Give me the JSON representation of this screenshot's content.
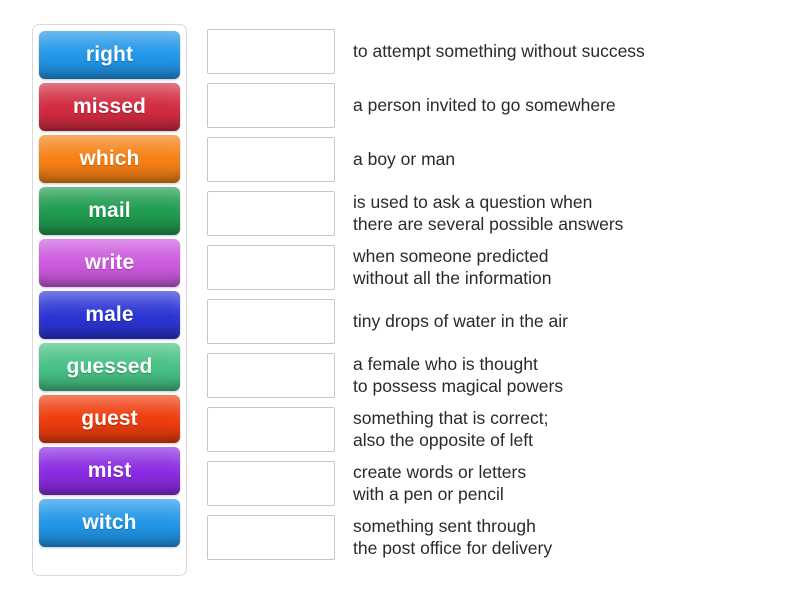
{
  "activity": {
    "type": "match-up",
    "tile_panel": {
      "name": "word-bank",
      "tiles": [
        {
          "label": "right",
          "color": "#2196e8"
        },
        {
          "label": "missed",
          "color": "#d22b41"
        },
        {
          "label": "which",
          "color": "#f58014"
        },
        {
          "label": "mail",
          "color": "#1e9b4e"
        },
        {
          "label": "write",
          "color": "#cc5ade"
        },
        {
          "label": "male",
          "color": "#2b35d4"
        },
        {
          "label": "guessed",
          "color": "#45c183"
        },
        {
          "label": "guest",
          "color": "#ee3c0d"
        },
        {
          "label": "mist",
          "color": "#8b2be2"
        },
        {
          "label": "witch",
          "color": "#2196e8"
        }
      ]
    },
    "answers": {
      "name": "definition-list",
      "rows": [
        {
          "value": "",
          "definition": "to attempt something without success"
        },
        {
          "value": "",
          "definition": "a person invited to go somewhere"
        },
        {
          "value": "",
          "definition": "a boy or man"
        },
        {
          "value": "",
          "definition": "is used to ask a question when\nthere are several possible answers"
        },
        {
          "value": "",
          "definition": "when someone predicted\nwithout all the information"
        },
        {
          "value": "",
          "definition": "tiny drops of water in the air"
        },
        {
          "value": "",
          "definition": "a female who is thought\nto possess magical powers"
        },
        {
          "value": "",
          "definition": "something that is correct;\nalso the opposite of left"
        },
        {
          "value": "",
          "definition": "create words or letters\nwith a pen or pencil"
        },
        {
          "value": "",
          "definition": "something sent through\nthe post office for delivery"
        }
      ]
    }
  }
}
